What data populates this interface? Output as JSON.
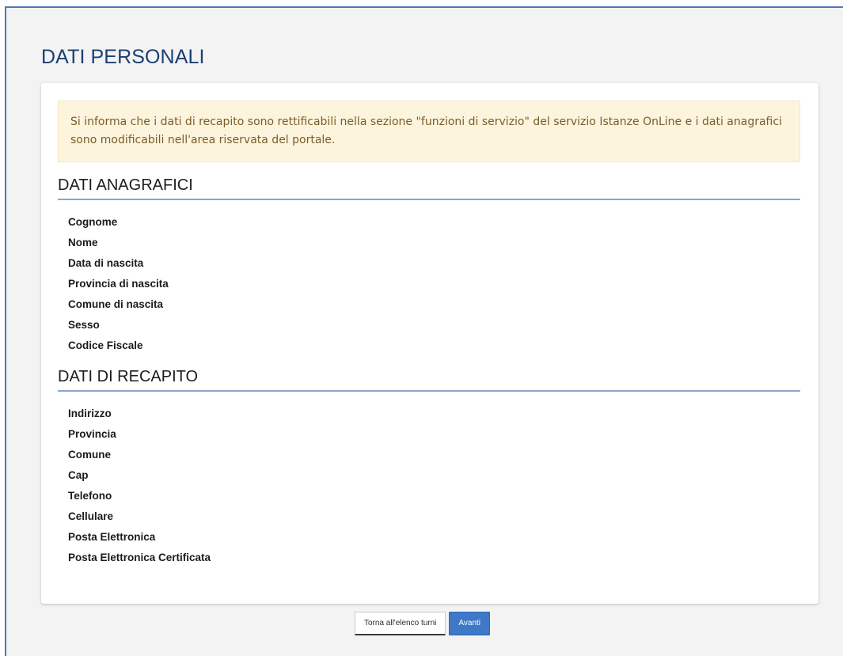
{
  "page": {
    "title": "DATI PERSONALI"
  },
  "notice": {
    "text": "Si informa che i dati di recapito sono rettificabili nella sezione \"funzioni di servizio\" del servizio Istanze OnLine e i dati anagrafici sono modificabili nell'area riservata del portale."
  },
  "anagrafici": {
    "title": "DATI ANAGRAFICI",
    "fields": [
      "Cognome",
      "Nome",
      "Data di nascita",
      "Provincia di nascita",
      "Comune di nascita",
      "Sesso",
      "Codice Fiscale"
    ]
  },
  "recapito": {
    "title": "DATI DI RECAPITO",
    "fields": [
      "Indirizzo",
      "Provincia",
      "Comune",
      "Cap",
      "Telefono",
      "Cellulare",
      "Posta Elettronica",
      "Posta Elettronica Certificata"
    ]
  },
  "actions": {
    "back_label": "Torna all'elenco turni",
    "next_label": "Avanti"
  },
  "colors": {
    "accent": "#3f78c6",
    "frame_border": "#4a79b8",
    "notice_bg": "#fdf4dd",
    "title": "#1a3f73"
  }
}
